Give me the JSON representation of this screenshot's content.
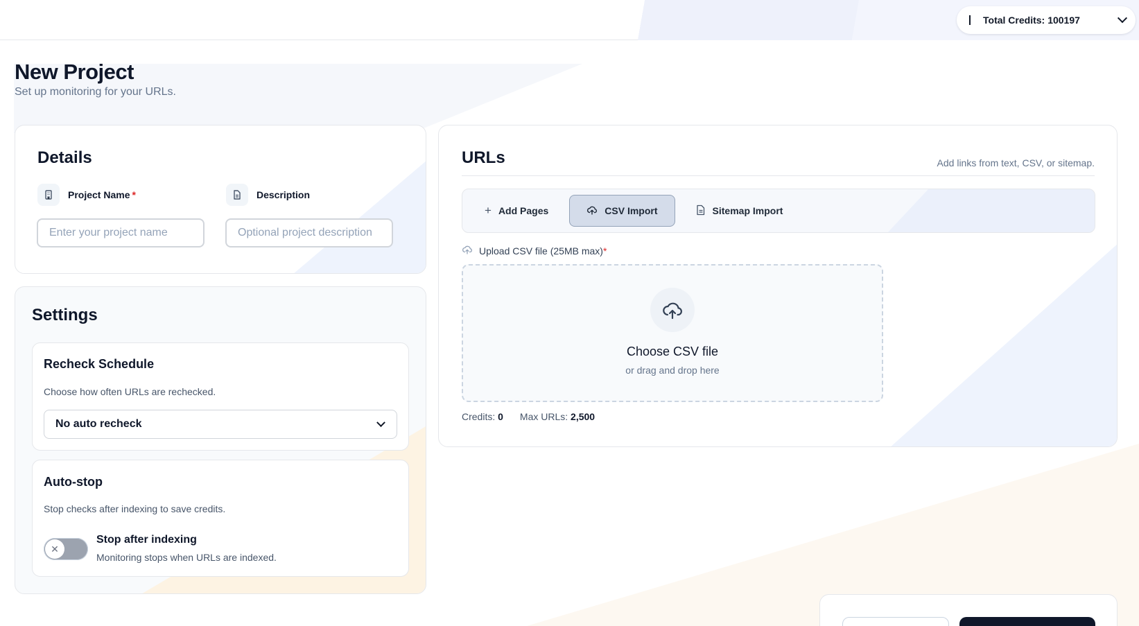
{
  "topbar": {
    "credits_label": "Total Credits:",
    "credits_value": "100197"
  },
  "page": {
    "title": "New Project",
    "subtitle": "Set up monitoring for your URLs."
  },
  "details": {
    "title": "Details",
    "project_name_label": "Project Name",
    "required_mark": "*",
    "description_label": "Description",
    "project_name_placeholder": "Enter your project name",
    "project_name_value": "",
    "description_placeholder": "Optional project description",
    "description_value": ""
  },
  "settings": {
    "title": "Settings",
    "recheck": {
      "title": "Recheck Schedule",
      "description": "Choose how often URLs are rechecked.",
      "selected": "No auto recheck"
    },
    "autostop": {
      "title": "Auto-stop",
      "description": "Stop checks after indexing to save credits.",
      "toggle_title": "Stop after indexing",
      "toggle_description": "Monitoring stops when URLs are indexed.",
      "toggle_on": false
    }
  },
  "urls": {
    "title": "URLs",
    "hint": "Add links from text, CSV, or sitemap.",
    "tabs": [
      {
        "label": "Add Pages",
        "icon": "plus-icon",
        "active": false
      },
      {
        "label": "CSV Import",
        "icon": "cloud-upload-icon",
        "active": true
      },
      {
        "label": "Sitemap Import",
        "icon": "document-icon",
        "active": false
      }
    ],
    "upload_label": "Upload CSV file (25MB max)",
    "required_mark": "*",
    "dropzone_title": "Choose CSV file",
    "dropzone_subtitle": "or drag and drop here",
    "credits_label": "Credits:",
    "credits_value": "0",
    "max_urls_label": "Max URLs:",
    "max_urls_value": "2,500"
  },
  "colors": {
    "primary_dark": "#0f172a",
    "required": "#dc2626",
    "accent_wash": "#eef3fd",
    "warm_wash": "#fdf8f1"
  }
}
